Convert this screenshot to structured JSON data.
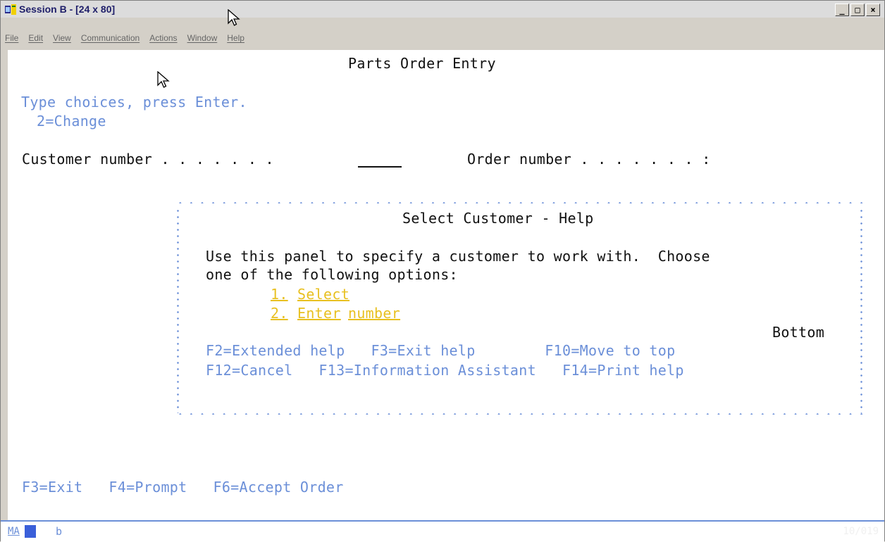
{
  "window": {
    "title": "Session B - [24 x 80]",
    "controls": [
      "_",
      "□",
      "×"
    ]
  },
  "menu": {
    "items": [
      "File",
      "Edit",
      "View",
      "Communication",
      "Actions",
      "Window",
      "Help"
    ]
  },
  "screen": {
    "title": "Parts Order Entry",
    "instructions": "Type choices, press Enter.",
    "option": "2=Change",
    "customer_label": "Customer number . . . . . . .",
    "order_label": "Order number . . . . . . . :",
    "customer_value": "",
    "function_keys": "F3=Exit   F4=Prompt   F6=Accept Order"
  },
  "help_window": {
    "title": "Select Customer - Help",
    "text_line1": "Use this panel to specify a customer to work with.  Choose",
    "text_line2": "one of the following options:",
    "link1_num": "1.",
    "link1_text": "Select",
    "link2_num": "2.",
    "link2_word1": "Enter",
    "link2_word2": "number",
    "position": "Bottom",
    "keys_line1": "F2=Extended help   F3=Exit help        F10=Move to top",
    "keys_line2": "F12=Cancel   F13=Information Assistant   F14=Print help"
  },
  "status": {
    "mode": "MA",
    "indicator": "b",
    "cursor_pos": "10/019"
  }
}
